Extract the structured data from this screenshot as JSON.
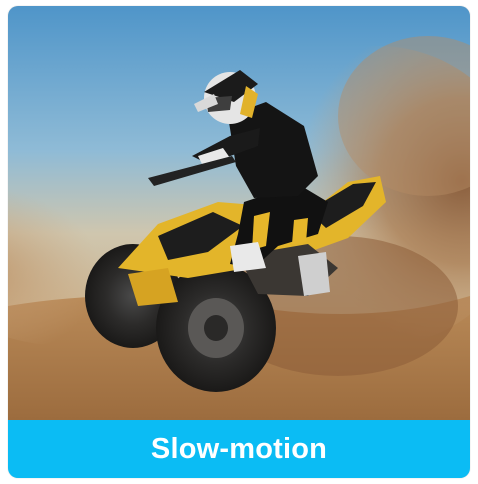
{
  "card": {
    "caption": "Slow-motion",
    "accent_color": "#0bbcf4",
    "image_subject": "atv-rider-dust-photo"
  }
}
